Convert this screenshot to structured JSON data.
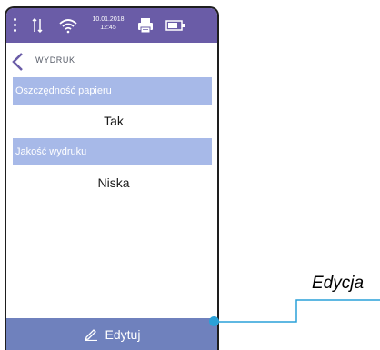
{
  "status_bar": {
    "date": "10.01.2018",
    "time": "12:45",
    "icons": [
      "menu-dots-icon",
      "transfer-arrows-icon",
      "wifi-icon",
      "printer-icon",
      "battery-icon"
    ]
  },
  "header": {
    "title": "WYDRUK",
    "back_icon": "chevron-left-icon"
  },
  "settings": [
    {
      "label": "Oszczędność papieru",
      "value": "Tak"
    },
    {
      "label": "Jakość wydruku",
      "value": "Niska"
    }
  ],
  "footer": {
    "edit_label": "Edytuj",
    "edit_icon": "pencil-icon"
  },
  "annotation": {
    "label": "Edycja"
  },
  "colors": {
    "status_bar": "#6a5ca7",
    "section_header": "#a7b9e8",
    "edit_bar": "#6f81bd",
    "callout": "#2aa1d8"
  }
}
